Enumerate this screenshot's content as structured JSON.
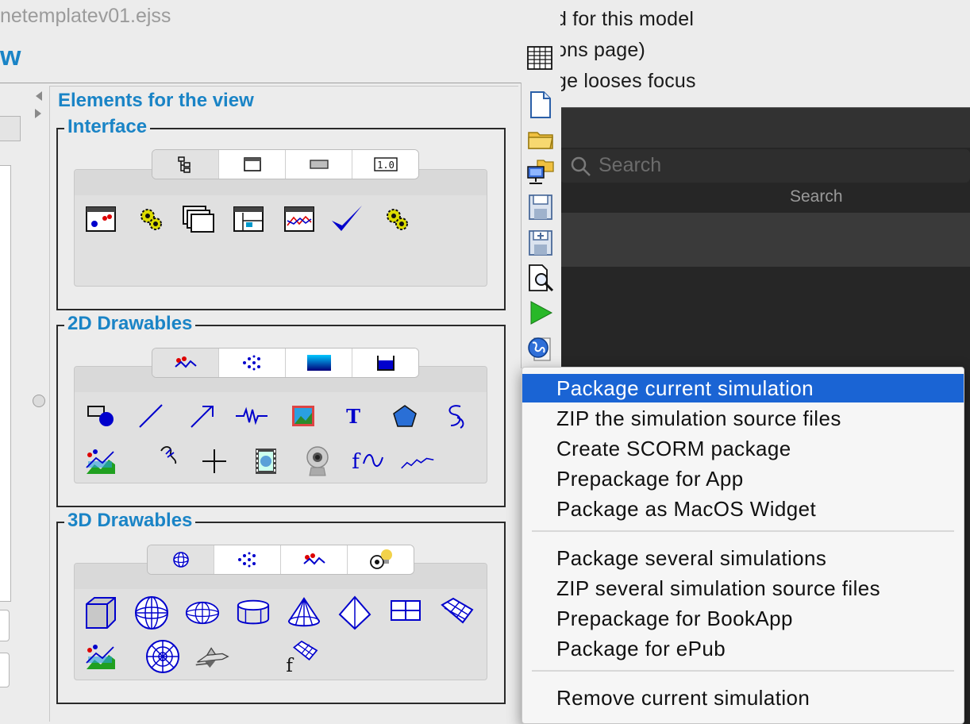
{
  "background_app": {
    "lines": [
      "d for this model",
      "ons page)",
      "ge looses focus"
    ],
    "search": {
      "placeholder": "Search",
      "label": "Search"
    }
  },
  "window": {
    "title": "netemplatev01.ejss",
    "heading": "w"
  },
  "elements_panel": {
    "title": "Elements for the view",
    "groups": {
      "interface": {
        "label": "Interface",
        "tabs": [
          "tree-icon",
          "window-icon",
          "button-icon",
          "number-field-icon"
        ],
        "selected_tab": 0,
        "tab_texts": {
          "number_field": "1.0"
        },
        "icons": [
          "plotting-panel-icon",
          "gear-element-icon",
          "stacked-panels-icon",
          "drawing-panel-icon",
          "chart-panel-icon",
          "checkmark-icon",
          "gear-element-2-icon"
        ]
      },
      "drawables2d": {
        "label": "2D Drawables",
        "tabs": [
          "drawables-icon",
          "particles-icon",
          "field-icon",
          "tank-icon"
        ],
        "selected_tab": 0,
        "text_icon": "T",
        "function_icon": "f",
        "icons": [
          "shape-icon",
          "segment-icon",
          "arrow-icon",
          "spring-icon",
          "image-icon",
          "text-icon",
          "polygon-icon",
          "trail-icon",
          "plot-icon",
          "cursor-icon",
          "crosshair-icon",
          "video-icon",
          "webcam-icon",
          "function-icon",
          "trace-icon"
        ]
      },
      "drawables3d": {
        "label": "3D Drawables",
        "tabs": [
          "sphere-tab-icon",
          "particles-3d-icon",
          "drawables-3d-icon",
          "light-icon"
        ],
        "selected_tab": 0,
        "function_icon": "f",
        "icons": [
          "box-icon",
          "sphere-icon",
          "ellipsoid-icon",
          "cylinder-icon",
          "cone-icon",
          "pyramid-icon",
          "plane-icon",
          "surface-icon",
          "plot-3d-icon",
          "mesh-icon",
          "shuttle-model-icon",
          "function-surface-icon"
        ]
      }
    }
  },
  "toolbar": {
    "icons": [
      "new-file-icon",
      "open-folder-icon",
      "open-network-icon",
      "save-icon",
      "save-as-icon",
      "search-document-icon",
      "run-icon",
      "package-web-icon"
    ]
  },
  "context_menu": {
    "active_index": 0,
    "sections": [
      [
        "Package current simulation",
        "ZIP the simulation source files",
        "Create SCORM package",
        "Prepackage for App",
        "Package as MacOS Widget"
      ],
      [
        "Package several simulations",
        "ZIP several simulation source files",
        "Prepackage for BookApp",
        "Package for ePub"
      ],
      [
        "Remove current simulation"
      ]
    ]
  },
  "colors": {
    "accent_blue": "#1a84c6",
    "menu_highlight": "#1a64d4",
    "icon_blue": "#0000cc"
  }
}
